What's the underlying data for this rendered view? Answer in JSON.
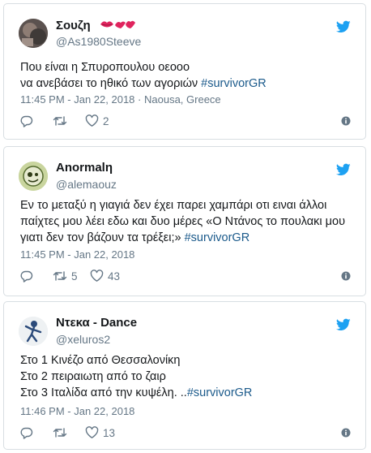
{
  "tweets": [
    {
      "name": "Σουζη",
      "handle": "@As1980Steeve",
      "text_plain": "Που είναι η Σπυροπουλου οεοοο\nνα ανεβάσει το ηθικό των αγοριών ",
      "hashtag": "#survivorGR",
      "text_after": "",
      "timestamp": "11:45 PM - Jan 22, 2018",
      "location": "Naousa, Greece",
      "retweets": "",
      "likes": "2",
      "avatar_color": "#7a6c66"
    },
    {
      "name": "Anormalη",
      "handle": "@alemaouz",
      "text_plain": "Εν το μεταξύ η γιαγιά δεν έχει παρει χαμπάρι οτι ειναι άλλοι παίχτες μου λέει εδω και δυο μέρες  «Ο Ντάνος το πουλακι μου γιατι δεν τον βάζουν τα τρέξει;» ",
      "hashtag": "#survivorGR",
      "text_after": "",
      "timestamp": "11:45 PM - Jan 22, 2018",
      "location": "",
      "retweets": "5",
      "likes": "43",
      "avatar_color": "#cfd9a8"
    },
    {
      "name": "Ντεκα - Dance",
      "handle": "@xeluros2",
      "text_plain": "Στο 1 Κινέζο από Θεσσαλονίκη\nΣτο 2 πειραιωτη από το ζαιρ\nΣτο 3 Ιταλίδα από την κυψέλη. ..",
      "hashtag": "#survivorGR",
      "text_after": "",
      "timestamp": "11:46 PM - Jan 22, 2018",
      "location": "",
      "retweets": "",
      "likes": "13",
      "avatar_color": "#e8ecef"
    }
  ],
  "colors": {
    "twitter_blue": "#1da1f2",
    "hashtag": "#1b5a8b",
    "muted": "#657786",
    "lips": "#e0245e"
  },
  "icons": [
    "twitter-bird-icon",
    "reply-icon",
    "retweet-icon",
    "like-icon",
    "info-icon",
    "kiss-lips-icon"
  ]
}
